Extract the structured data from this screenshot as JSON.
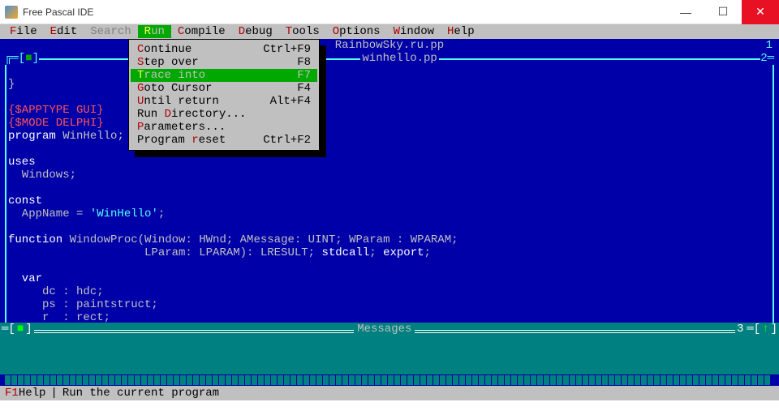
{
  "window": {
    "title": "Free Pascal IDE"
  },
  "menu": {
    "items": [
      {
        "hot": "F",
        "rest": "ile"
      },
      {
        "hot": "E",
        "rest": "dit"
      },
      {
        "hot": "S",
        "rest": "earch",
        "disabled": true
      },
      {
        "hot": "R",
        "rest": "un",
        "active": true
      },
      {
        "hot": "C",
        "rest": "ompile"
      },
      {
        "hot": "D",
        "rest": "ebug"
      },
      {
        "hot": "T",
        "rest": "ools"
      },
      {
        "hot": "O",
        "rest": "ptions"
      },
      {
        "hot": "W",
        "rest": "indow"
      },
      {
        "hot": "H",
        "rest": "elp"
      }
    ]
  },
  "dropdown": {
    "items": [
      {
        "hot": "C",
        "rest": "ontinue",
        "shortcut": "Ctrl+F9"
      },
      {
        "hot": "S",
        "rest": "tep over",
        "shortcut": "F8"
      },
      {
        "hot": "T",
        "rest": "race into",
        "shortcut": "F7",
        "selected": true
      },
      {
        "hot": "G",
        "rest": "oto Cursor",
        "shortcut": "F4"
      },
      {
        "hot": "U",
        "rest": "ntil return",
        "shortcut": "Alt+F4"
      },
      {
        "pre": "Run ",
        "hot": "D",
        "rest": "irectory...",
        "shortcut": ""
      },
      {
        "pre": "",
        "hot": "P",
        "rest": "arameters...",
        "shortcut": ""
      },
      {
        "pre": "Program ",
        "hot": "r",
        "rest": "eset",
        "shortcut": "Ctrl+F2"
      }
    ]
  },
  "tabs": {
    "file1": "RainbowSky.ru.pp",
    "file1_no": "1",
    "file2": "winhello.pp",
    "file2_no": "2"
  },
  "code": {
    "l1": "}",
    "d1": "{$APPTYPE GUI}",
    "d2": "{$MODE DELPHI}",
    "k_program": "program ",
    "progname": "WinHello",
    "semi": ";",
    "k_uses": "uses",
    "uses1": "  Windows;",
    "k_const": "const",
    "const1_a": "  AppName = ",
    "const1_b": "'WinHello'",
    "const1_c": ";",
    "k_function": "function ",
    "fn1": "WindowProc(Window: HWnd; AMessage: UINT; WParam : WPARAM;",
    "fn2": "                    LParam: LPARAM): LRESULT; ",
    "k_stdcall": "stdcall",
    "fn3": "; ",
    "k_export": "export",
    "fn4": ";",
    "k_var": "  var",
    "v1": "     dc : hdc;",
    "v2": "     ps : paintstruct;",
    "v3": "     r  : rect;"
  },
  "messages": {
    "title": "Messages",
    "num": "3"
  },
  "status": {
    "fkey": "F1",
    "help": " Help",
    "sep": "|",
    "hint": "Run the current program"
  }
}
